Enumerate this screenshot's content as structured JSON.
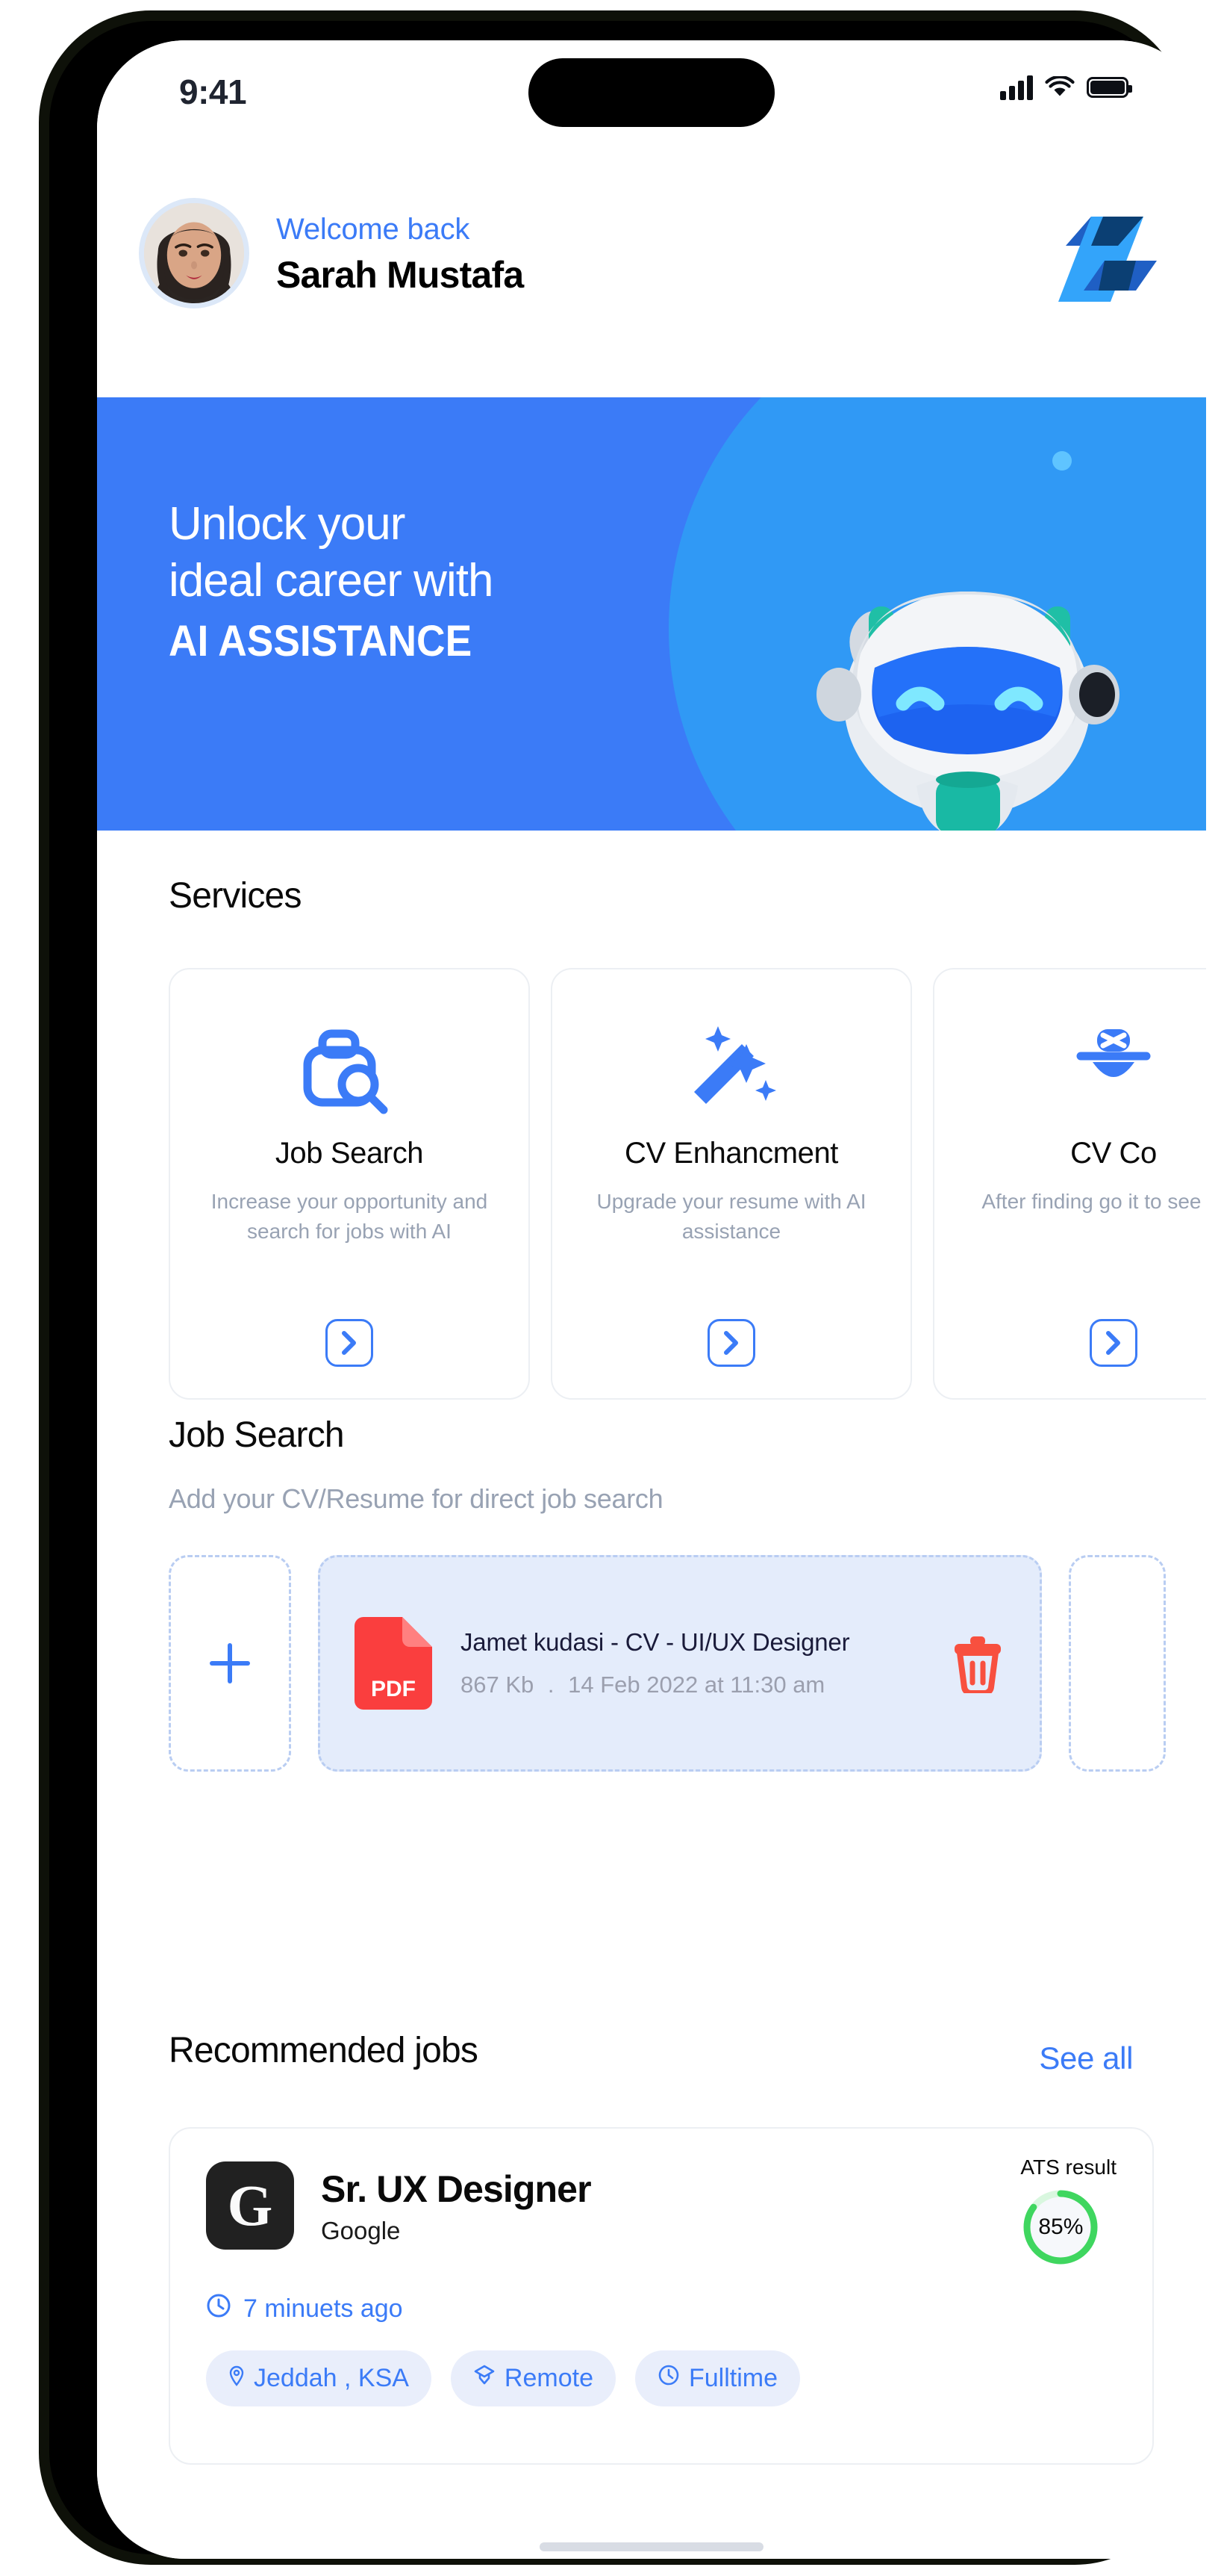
{
  "status_bar": {
    "time": "9:41",
    "icons": [
      "cellular-signal-icon",
      "wifi-icon",
      "battery-icon"
    ]
  },
  "header": {
    "welcome_label": "Welcome back",
    "user_name": "Sarah Mustafa",
    "avatar": "user-avatar",
    "logo": "brand-logo-z"
  },
  "hero": {
    "line1": "Unlock your",
    "line2": "ideal career with",
    "line3": "AI ASSISTANCE",
    "bg_color": "#3b7bf7",
    "accent_color": "#2f9ff5",
    "illustration": "ai-robot-mascot"
  },
  "services": {
    "title": "Services",
    "cards": [
      {
        "icon": "briefcase-search-icon",
        "name": "Job Search",
        "desc": "Increase your opportunity and search for jobs with AI",
        "arrow": "chevron-right-icon"
      },
      {
        "icon": "magic-wand-sparkle-icon",
        "name": "CV Enhancment",
        "desc": "Upgrade your resume with AI assistance",
        "arrow": "chevron-right-icon"
      },
      {
        "icon": "cv-compare-icon",
        "name": "CV Co",
        "desc": "After finding go it to see how",
        "arrow": "chevron-right-icon"
      }
    ]
  },
  "job_search": {
    "title": "Job Search",
    "subtitle": "Add your CV/Resume for direct job search",
    "add_button": "plus-icon",
    "file": {
      "type_badge": "PDF",
      "name": "Jamet kudasi - CV - UI/UX Designer",
      "size": "867 Kb",
      "separator": ".",
      "date": "14 Feb 2022 at 11:30 am",
      "delete": "trash-icon"
    }
  },
  "recommended": {
    "title": "Recommended jobs",
    "see_all": "See all",
    "job": {
      "logo_letter": "G",
      "title": "Sr. UX Designer",
      "company": "Google",
      "ats_label": "ATS result",
      "ats_value": "85%",
      "ats_percent": 85,
      "ats_color": "#3fd65f",
      "posted": "7 minuets ago",
      "clock_icon": "clock-icon",
      "tags": [
        {
          "icon": "location-pin-icon",
          "label": "Jeddah , KSA"
        },
        {
          "icon": "remote-badge-icon",
          "label": "Remote"
        },
        {
          "icon": "clock-icon",
          "label": "Fulltime"
        }
      ]
    }
  }
}
